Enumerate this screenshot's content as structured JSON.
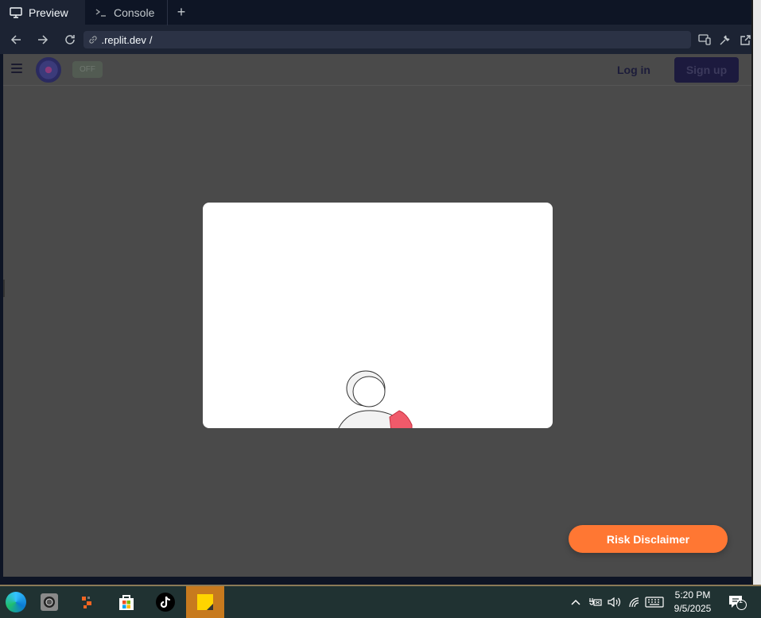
{
  "tabs": [
    {
      "label": "Preview",
      "icon": "monitor-icon",
      "active": true
    },
    {
      "label": "Console",
      "icon": "terminal-icon",
      "active": false
    }
  ],
  "new_tab_label": "+",
  "url": {
    "prefix": ".replit.dev",
    "suffix": "/"
  },
  "site": {
    "toggle_label": "OFF",
    "login_label": "Log in",
    "signup_label": "Sign up",
    "risk_label": "Risk Disclaimer"
  },
  "taskbar": {
    "time": "5:20 PM",
    "date": "9/5/2025",
    "notification_count": "1"
  },
  "colors": {
    "accent_orange": "#ff7733",
    "signup_bg": "#1c1a3e",
    "overlay_bg": "#4a4a4a",
    "taskbar_active": "#c77a1e"
  }
}
